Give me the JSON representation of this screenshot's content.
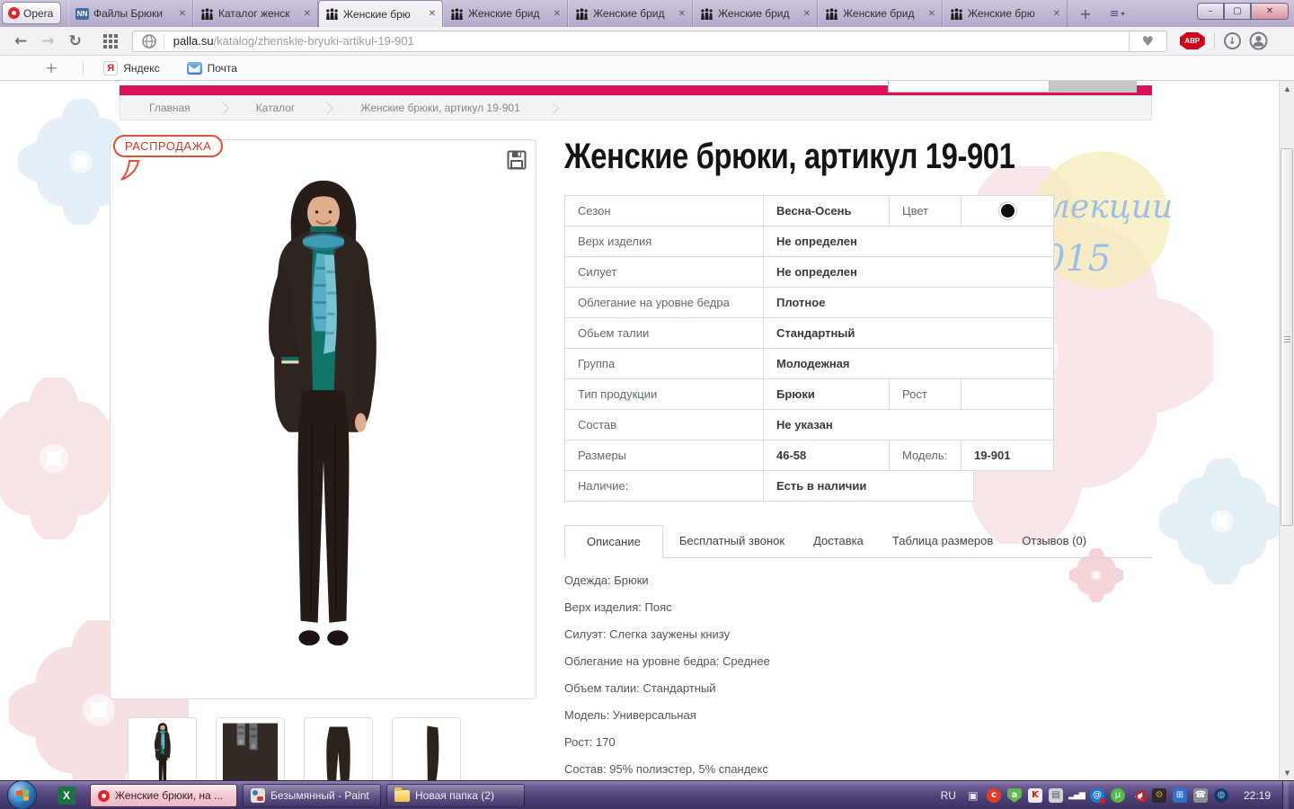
{
  "browser": {
    "opera_button": "Opera",
    "tabs": [
      {
        "label": "Файлы Брюки",
        "icon": "nn-site-icon"
      },
      {
        "label": "Каталог женск",
        "icon": "people-icon"
      },
      {
        "label": "Женские брю",
        "icon": "people-icon",
        "active": true
      },
      {
        "label": "Женские брид",
        "icon": "people-icon"
      },
      {
        "label": "Женские брид",
        "icon": "people-icon"
      },
      {
        "label": "Женские брид",
        "icon": "people-icon"
      },
      {
        "label": "Женские брид",
        "icon": "people-icon"
      },
      {
        "label": "Женские брю",
        "icon": "people-icon"
      }
    ],
    "address": {
      "host": "palla.su",
      "path": "/katalog/zhenskie-bryuki-artikul-19-901"
    },
    "bookmarks": {
      "yandex": "Яндекс",
      "mail": "Почта"
    }
  },
  "icons": {
    "back": "←",
    "forward": "→",
    "reload": "↻",
    "heart": "♥",
    "download": "↓",
    "profile": "◉",
    "abp": "ABP",
    "nn": "NN",
    "yandex_initial": "Я",
    "plus": "+",
    "new_tab": "+",
    "tab_menu": "≡",
    "caret": "▾",
    "minimize": "–",
    "maximize": "▢",
    "close": "✕",
    "tab_close": "✕",
    "scroll_up": "▲",
    "scroll_down": "▼",
    "tray_windows_stack": "▣",
    "tray_ccleaner": "c",
    "tray_adguard": "a",
    "tray_kaspersky": "K",
    "tray_clipboard": "▤",
    "tray_signal": "▂▄▆",
    "tray_mail_alert": "@",
    "tray_utorrent": "µ",
    "tray_volume": "◀",
    "tray_tools": "⚙",
    "tray_update": "⊞",
    "tray_phone": "☎",
    "tray_globe": "◍",
    "excel": "X"
  },
  "page": {
    "breadcrumb": {
      "home": "Главная",
      "catalog": "Каталог",
      "current": "Женские брюки, артикул 19-901"
    },
    "sale_badge": "РАСПРОДАЖА",
    "title": "Женские брюки, артикул 19-901",
    "watermark": {
      "line1": "лекции",
      "line2": "015"
    },
    "specs": {
      "color_swatch": "#0d0d0d",
      "rows": [
        {
          "label": "Сезон",
          "value": "Весна-Осень",
          "label2": "Цвет"
        },
        {
          "label": "Верх изделия",
          "value": "Не определен"
        },
        {
          "label": "Силует",
          "value": "Не определен"
        },
        {
          "label": "Облегание на уровне бедра",
          "value": "Плотное"
        },
        {
          "label": "Обьем талии",
          "value": "Стандартный"
        },
        {
          "label": "Группа",
          "value": "Молодежная"
        },
        {
          "label": "Тип продукции",
          "value": "Брюки",
          "label2": "Рост",
          "value2": ""
        },
        {
          "label": "Состав",
          "value": "Не указан"
        },
        {
          "label": "Размеры",
          "value": "46-58",
          "label2": "Модель:",
          "value2": "19-901"
        },
        {
          "label": "Наличие:",
          "value": "Есть в наличии"
        }
      ]
    },
    "tabs": [
      {
        "label": "Описание",
        "active": true
      },
      {
        "label": "Бесплатный звонок"
      },
      {
        "label": "Доставка"
      },
      {
        "label": "Таблица размеров"
      },
      {
        "label": "Отзывов (0)"
      }
    ],
    "description": [
      "Одежда: Брюки",
      "Верх изделия: Пояс",
      "Силуэт: Слегка заужены книзу",
      "Облегание на уровне бедра: Среднее",
      "Объем талии: Стандартный",
      "Модель: Универсальная",
      "Рост: 170",
      "Состав: 95% полиэстер, 5% спандекс"
    ]
  },
  "taskbar": {
    "tasks": [
      {
        "label": "Женские брюки, на ...",
        "active": true
      },
      {
        "label": "Безымянный - Paint"
      },
      {
        "label": "Новая папка (2)"
      }
    ],
    "tray": {
      "lang": "RU",
      "time": "22:19"
    }
  },
  "colors": {
    "accent": "#d9115a",
    "sale_red": "#cc3726",
    "taskbar_purple": "#4e4278"
  }
}
